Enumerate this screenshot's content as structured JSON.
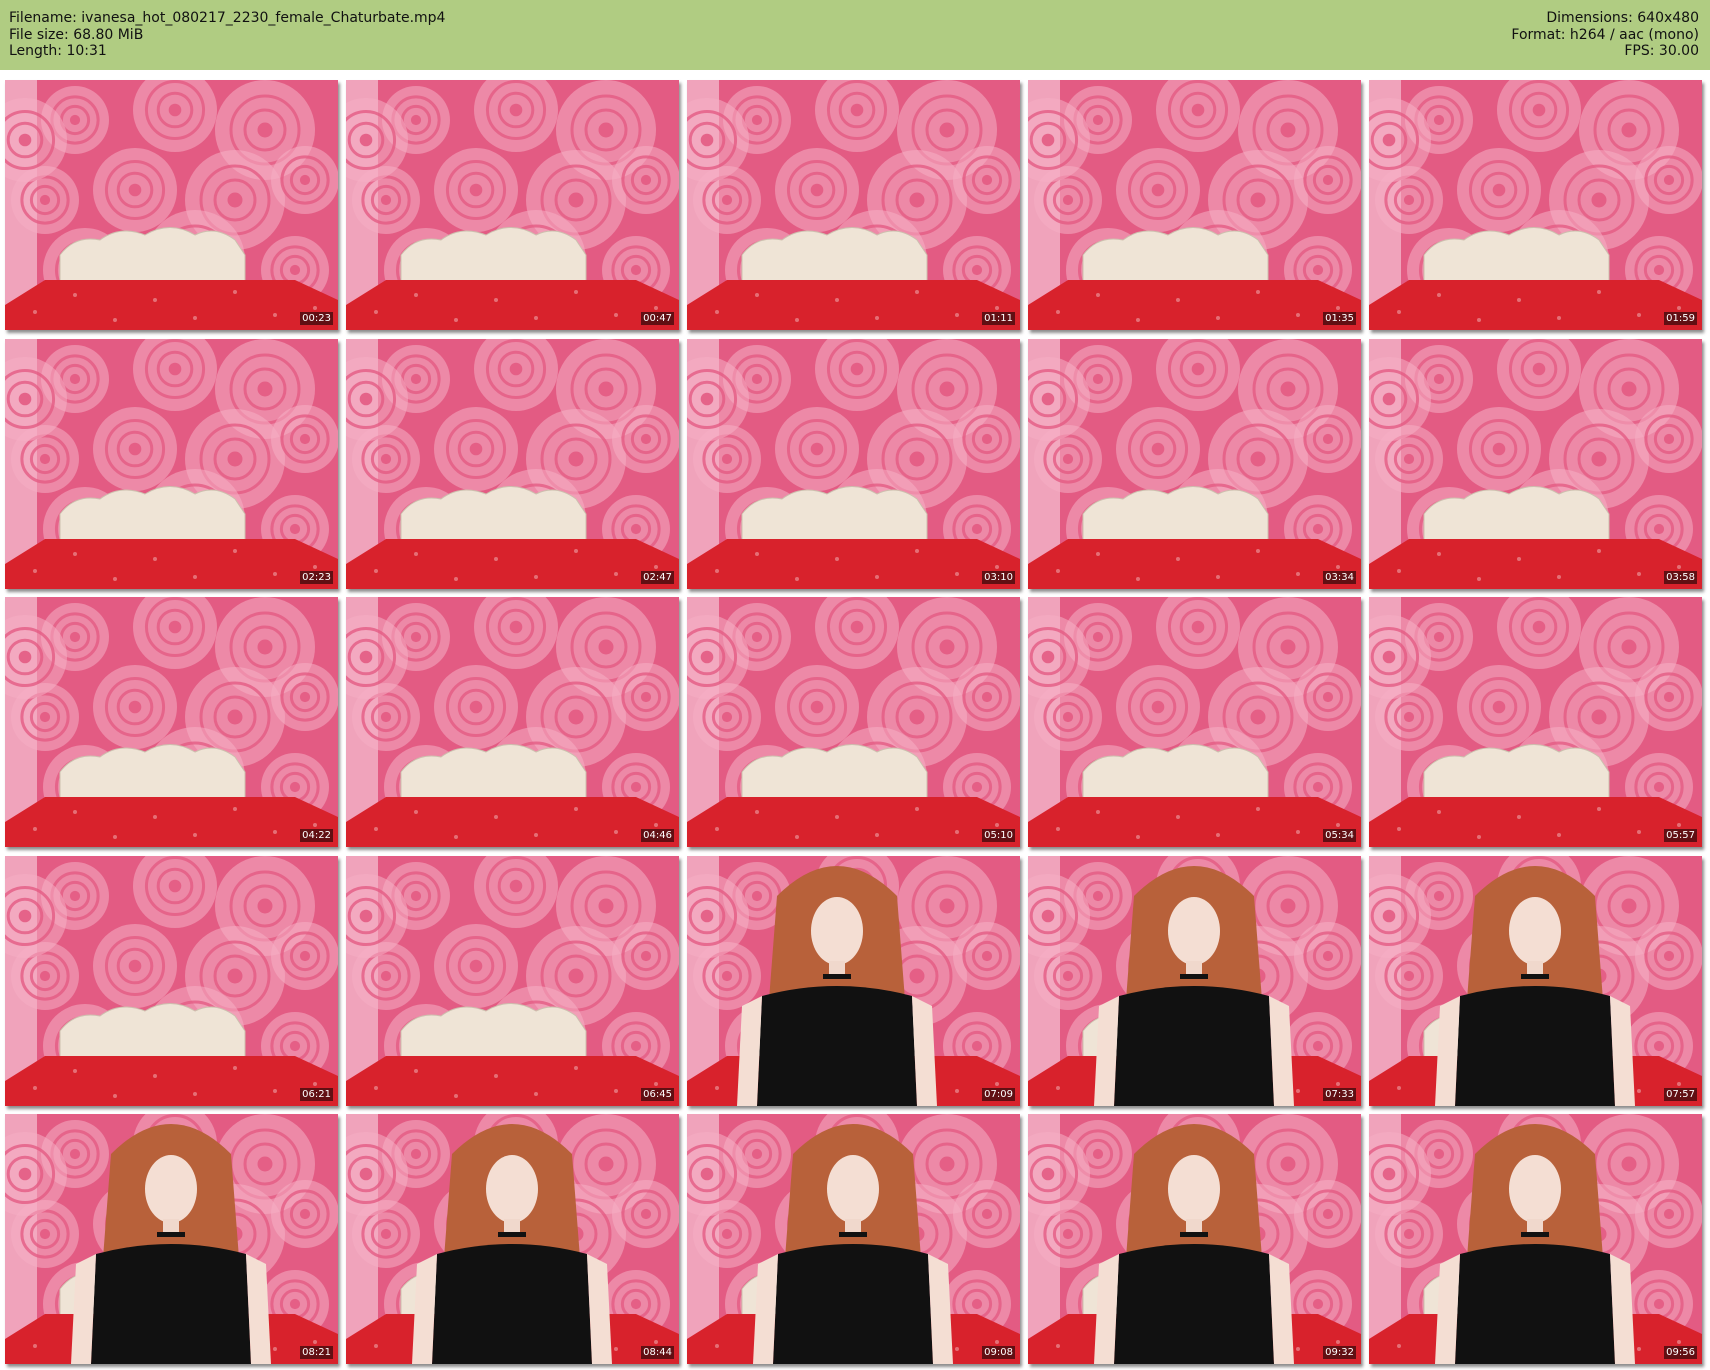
{
  "header": {
    "filename": "Filename: ivanesa_hot_080217_2230_female_Chaturbate.mp4",
    "filesize": "File size: 68.80 MiB",
    "length": "Length: 10:31",
    "dimensions": "Dimensions: 640x480",
    "format": "Format: h264 / aac (mono)",
    "fps": "FPS: 30.00"
  },
  "colors": {
    "header_bg": "#b0cc82",
    "wallpaper": "#e35b83",
    "rose_light": "#f6aec4",
    "bedspread": "#d8222c",
    "headboard": "#efe4d6",
    "hair": "#b8613a",
    "top": "#111111"
  },
  "thumbnails": [
    {
      "time": "00:23",
      "scene": "empty-bed"
    },
    {
      "time": "00:47",
      "scene": "empty-bed"
    },
    {
      "time": "01:11",
      "scene": "empty-bed"
    },
    {
      "time": "01:35",
      "scene": "empty-bed"
    },
    {
      "time": "01:59",
      "scene": "empty-bed"
    },
    {
      "time": "02:23",
      "scene": "empty-bed"
    },
    {
      "time": "02:47",
      "scene": "empty-bed"
    },
    {
      "time": "03:10",
      "scene": "empty-bed"
    },
    {
      "time": "03:34",
      "scene": "empty-bed"
    },
    {
      "time": "03:58",
      "scene": "empty-bed"
    },
    {
      "time": "04:22",
      "scene": "empty-bed"
    },
    {
      "time": "04:46",
      "scene": "empty-bed"
    },
    {
      "time": "05:10",
      "scene": "empty-bed"
    },
    {
      "time": "05:34",
      "scene": "empty-bed"
    },
    {
      "time": "05:57",
      "scene": "empty-bed"
    },
    {
      "time": "06:21",
      "scene": "empty-bed"
    },
    {
      "time": "06:45",
      "scene": "empty-bed"
    },
    {
      "time": "07:09",
      "scene": "person-side"
    },
    {
      "time": "07:33",
      "scene": "person"
    },
    {
      "time": "07:57",
      "scene": "person"
    },
    {
      "time": "08:21",
      "scene": "person"
    },
    {
      "time": "08:44",
      "scene": "person"
    },
    {
      "time": "09:08",
      "scene": "person"
    },
    {
      "time": "09:32",
      "scene": "person"
    },
    {
      "time": "09:56",
      "scene": "person"
    }
  ]
}
